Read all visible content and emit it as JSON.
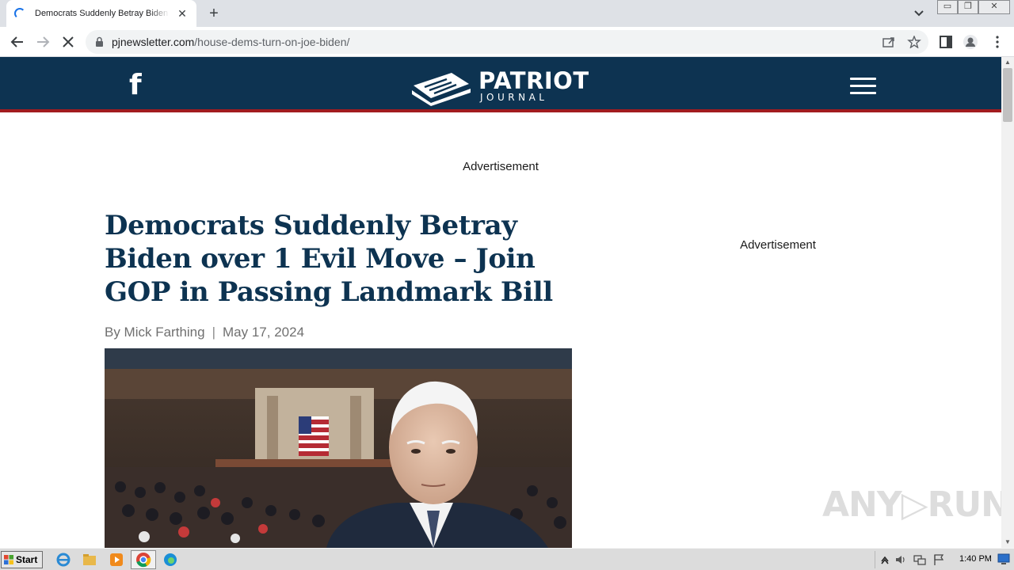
{
  "browser": {
    "tab_title": "Democrats Suddenly Betray Biden over 1 Evil Move – Join GOP in Passing Landmark Bill",
    "tab_close": "✕",
    "new_tab": "+",
    "url_host": "pjnewsletter.com",
    "url_path": "/house-dems-turn-on-joe-biden/",
    "window_controls": {
      "minimize": "▭",
      "restore": "❐",
      "close": "✕"
    }
  },
  "site": {
    "facebook_glyph": "f",
    "logo_word": "PATRIOT",
    "logo_sub": "JOURNAL",
    "header_color": "#0d3351",
    "accent_color": "#a11c1f"
  },
  "ads": {
    "top_label": "Advertisement",
    "side_label": "Advertisement"
  },
  "article": {
    "headline": "Democrats Suddenly Betray Biden over 1 Evil Move – Join GOP in Passing Landmark Bill",
    "byline": "By Mick Farthing",
    "separator": "|",
    "date": "May 17, 2024"
  },
  "watermark": "ANY▷RUN",
  "taskbar": {
    "start_label": "Start",
    "clock": "1:40 PM"
  }
}
